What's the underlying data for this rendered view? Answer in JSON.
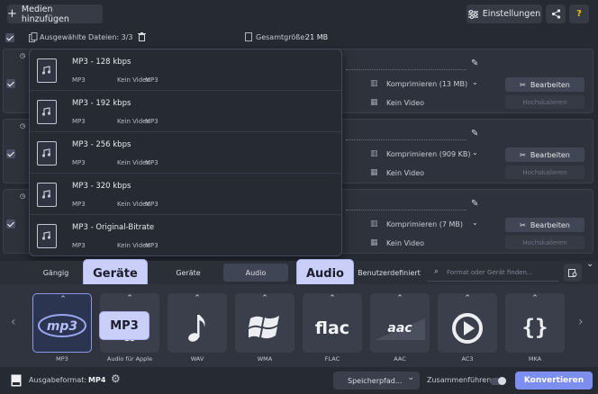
{
  "toolbar": {
    "add_media": "Medien hinzufügen",
    "settings": "Einstellungen",
    "help": "?"
  },
  "infobar": {
    "selected_files": "Ausgewählte Dateien: 3/3",
    "total_size_label": "Gesamtgröße:",
    "total_size_value": "21 MB"
  },
  "files": [
    {
      "compress": "Komprimieren (13 MB)",
      "video": "Kein Video",
      "edit": "Bearbeiten",
      "upscale": "Hochskalieren"
    },
    {
      "compress": "Komprimieren (909 KB)",
      "video": "Kein Video",
      "edit": "Bearbeiten",
      "upscale": "Hochskalieren"
    },
    {
      "compress": "Komprimieren (7 MB)",
      "video": "Kein Video",
      "edit": "Bearbeiten",
      "upscale": "Hochskalieren"
    }
  ],
  "dropdown": {
    "items": [
      {
        "title": "MP3 - 128 kbps",
        "c1": "MP3",
        "c2": "Kein Video",
        "c3": "MP3"
      },
      {
        "title": "MP3 - 192 kbps",
        "c1": "MP3",
        "c2": "Kein Video",
        "c3": "MP3"
      },
      {
        "title": "MP3 - 256 kbps",
        "c1": "MP3",
        "c2": "Kein Video",
        "c3": "MP3"
      },
      {
        "title": "MP3 - 320 kbps",
        "c1": "MP3",
        "c2": "Kein Video",
        "c3": "MP3"
      },
      {
        "title": "MP3 - Original-Bitrate",
        "c1": "MP3",
        "c2": "Kein Video",
        "c3": "MP3"
      }
    ]
  },
  "tabs": {
    "t1": "Gängig",
    "t2": "Geräte",
    "t3": "Audio",
    "t4": "Benutzerdefiniert",
    "search_placeholder": "Format oder Gerät finden..."
  },
  "callouts": {
    "devices": "Geräte",
    "audio": "Audio",
    "mp3": "MP3"
  },
  "formats": [
    {
      "label": "MP3",
      "icon": "mp3"
    },
    {
      "label": "Audio für Apple",
      "icon": ""
    },
    {
      "label": "WAV",
      "icon": "wav-note"
    },
    {
      "label": "WMA",
      "icon": "windows"
    },
    {
      "label": "FLAC",
      "icon": "flac"
    },
    {
      "label": "AAC",
      "icon": "aac"
    },
    {
      "label": "AC3",
      "icon": "play-circle"
    },
    {
      "label": "MKA",
      "icon": "braces"
    }
  ],
  "bottom": {
    "output_label": "Ausgabeformat:",
    "output_value": "MP4",
    "save_path": "Speicherpfad...",
    "merge": "Zusammenführen:",
    "convert": "Konvertieren"
  },
  "colors": {
    "accent": "#7c8ef0",
    "callout_bg": "#c9cff9",
    "background": "#262a33"
  }
}
